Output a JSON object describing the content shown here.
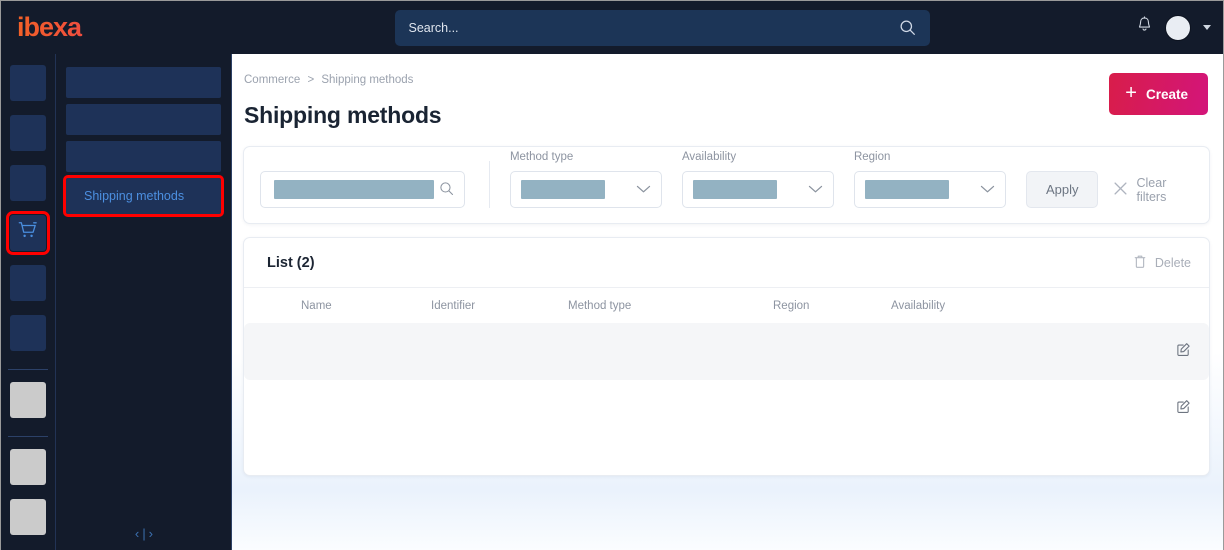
{
  "topbar": {
    "logo_text": "ibexa",
    "search_placeholder": "Search...",
    "search_value": "",
    "search_icon": "search-icon",
    "notification_icon": "bell-icon",
    "avatar_label": "",
    "user_menu_icon": "chevron-down-icon"
  },
  "colors": {
    "brand_gradient_start": "#f26522",
    "brand_gradient_end": "#dd1f63",
    "create_button_start": "#d81d4a",
    "create_button_end": "#d3157a",
    "topbar_bg": "#131b2b",
    "sidebar_tile": "#1e3258",
    "highlight_outline": "#ff0000",
    "active_nav_text": "#4c8fe0",
    "redacted_filter": "#93b2c2",
    "redacted_cell": "#cbcbcb"
  },
  "sidebar_primary": {
    "items": [
      {
        "label": "",
        "icon": "placeholder-icon",
        "active": false,
        "style": "blue"
      },
      {
        "label": "",
        "icon": "placeholder-icon",
        "active": false,
        "style": "blue"
      },
      {
        "label": "",
        "icon": "placeholder-icon",
        "active": false,
        "style": "blue"
      },
      {
        "label": "",
        "icon": "shopping-cart-icon",
        "active": true,
        "style": "blue"
      },
      {
        "label": "",
        "icon": "placeholder-icon",
        "active": false,
        "style": "blue"
      },
      {
        "label": "",
        "icon": "placeholder-icon",
        "active": false,
        "style": "blue"
      }
    ],
    "bottom_items": [
      {
        "label": "",
        "icon": "placeholder-icon",
        "style": "gray"
      },
      {
        "label": "",
        "icon": "placeholder-icon",
        "style": "gray"
      },
      {
        "label": "",
        "icon": "placeholder-icon",
        "style": "gray"
      }
    ]
  },
  "sidebar_secondary": {
    "items": [
      {
        "label": "",
        "active": false
      },
      {
        "label": "",
        "active": false
      },
      {
        "label": "",
        "active": false
      },
      {
        "label": "Shipping methods",
        "active": true
      }
    ],
    "collapse_icon": "collapse-panel-icon",
    "collapse_glyph": "‹|›"
  },
  "header": {
    "breadcrumb": [
      "Commerce",
      "Shipping methods"
    ],
    "breadcrumb_separator": ">",
    "page_title": "Shipping methods",
    "create_label": "Create",
    "create_icon": "plus-icon"
  },
  "filters": {
    "search": {
      "name": "filter-search-input",
      "value": "",
      "icon": "search-icon"
    },
    "selects": [
      {
        "label": "Method type",
        "value": "",
        "icon": "chevron-down-icon"
      },
      {
        "label": "Availability",
        "value": "",
        "icon": "chevron-down-icon"
      },
      {
        "label": "Region",
        "value": "",
        "icon": "chevron-down-icon"
      }
    ],
    "apply_label": "Apply",
    "clear_label": "Clear filters",
    "clear_icon": "close-x-icon"
  },
  "list": {
    "title": "List (2)",
    "count": 2,
    "delete_label": "Delete",
    "delete_icon": "trash-icon",
    "columns": [
      "Name",
      "Identifier",
      "Method type",
      "Region",
      "Availability"
    ],
    "rows": [
      {
        "selected": false,
        "name": "",
        "identifier": "",
        "method_type": "",
        "region": "",
        "availability": "",
        "edit_icon": "edit-pencil-icon"
      },
      {
        "selected": false,
        "name": "",
        "identifier": "",
        "method_type": "",
        "region": "",
        "availability": "",
        "edit_icon": "edit-pencil-icon"
      }
    ]
  }
}
